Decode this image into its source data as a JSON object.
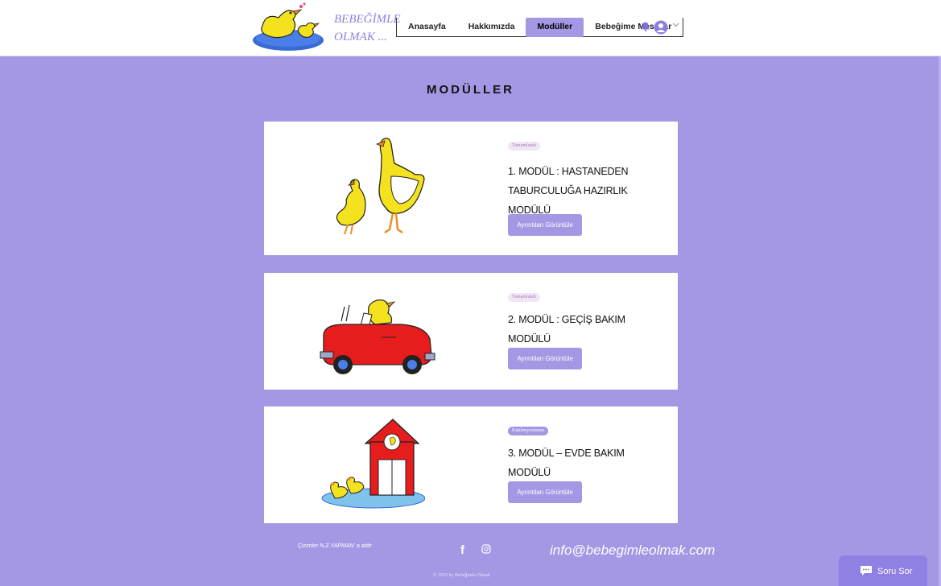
{
  "header": {
    "logo_line1": "BEBEĞİMLE",
    "logo_line2": "OLMAK ...",
    "nav": [
      "Anasayfa",
      "Hakkımızda",
      "Modüller",
      "Bebeğime Mesajlar"
    ],
    "active_nav": "Modüller",
    "icons": [
      "bell-icon",
      "user-avatar-icon",
      "chevron-down-icon"
    ]
  },
  "page": {
    "title": "MODÜLLER"
  },
  "modules": [
    {
      "badge": "Tamamlandı",
      "title": "1. MODÜL : HASTANEDEN TABURCULUĞA HAZIRLIK MODÜLÜ",
      "button": "Ayrıntıları Görüntüle"
    },
    {
      "badge": "Tamamlandı",
      "title": "2. MODÜL : GEÇİŞ BAKIM MODÜLÜ",
      "button": "Ayrıntıları Görüntüle"
    },
    {
      "badge": "Katılmıyorsunuz",
      "title": "3. MODÜL – EVDE BAKIM MODÜLÜ",
      "button": "Ayrıntıları Görüntüle"
    }
  ],
  "footer": {
    "credit": "Çizimler N.Z.YAPMAN' a aittir",
    "email": "info@bebegimleolmak.com",
    "copyright": "© 2023 by Bebeğimle Olmak",
    "social_icons": [
      "facebook-icon",
      "instagram-icon"
    ]
  },
  "chat": {
    "label": "Soru Sor"
  },
  "colors": {
    "accent": "#a497e4",
    "card": "#ffffff",
    "text": "#111111"
  }
}
